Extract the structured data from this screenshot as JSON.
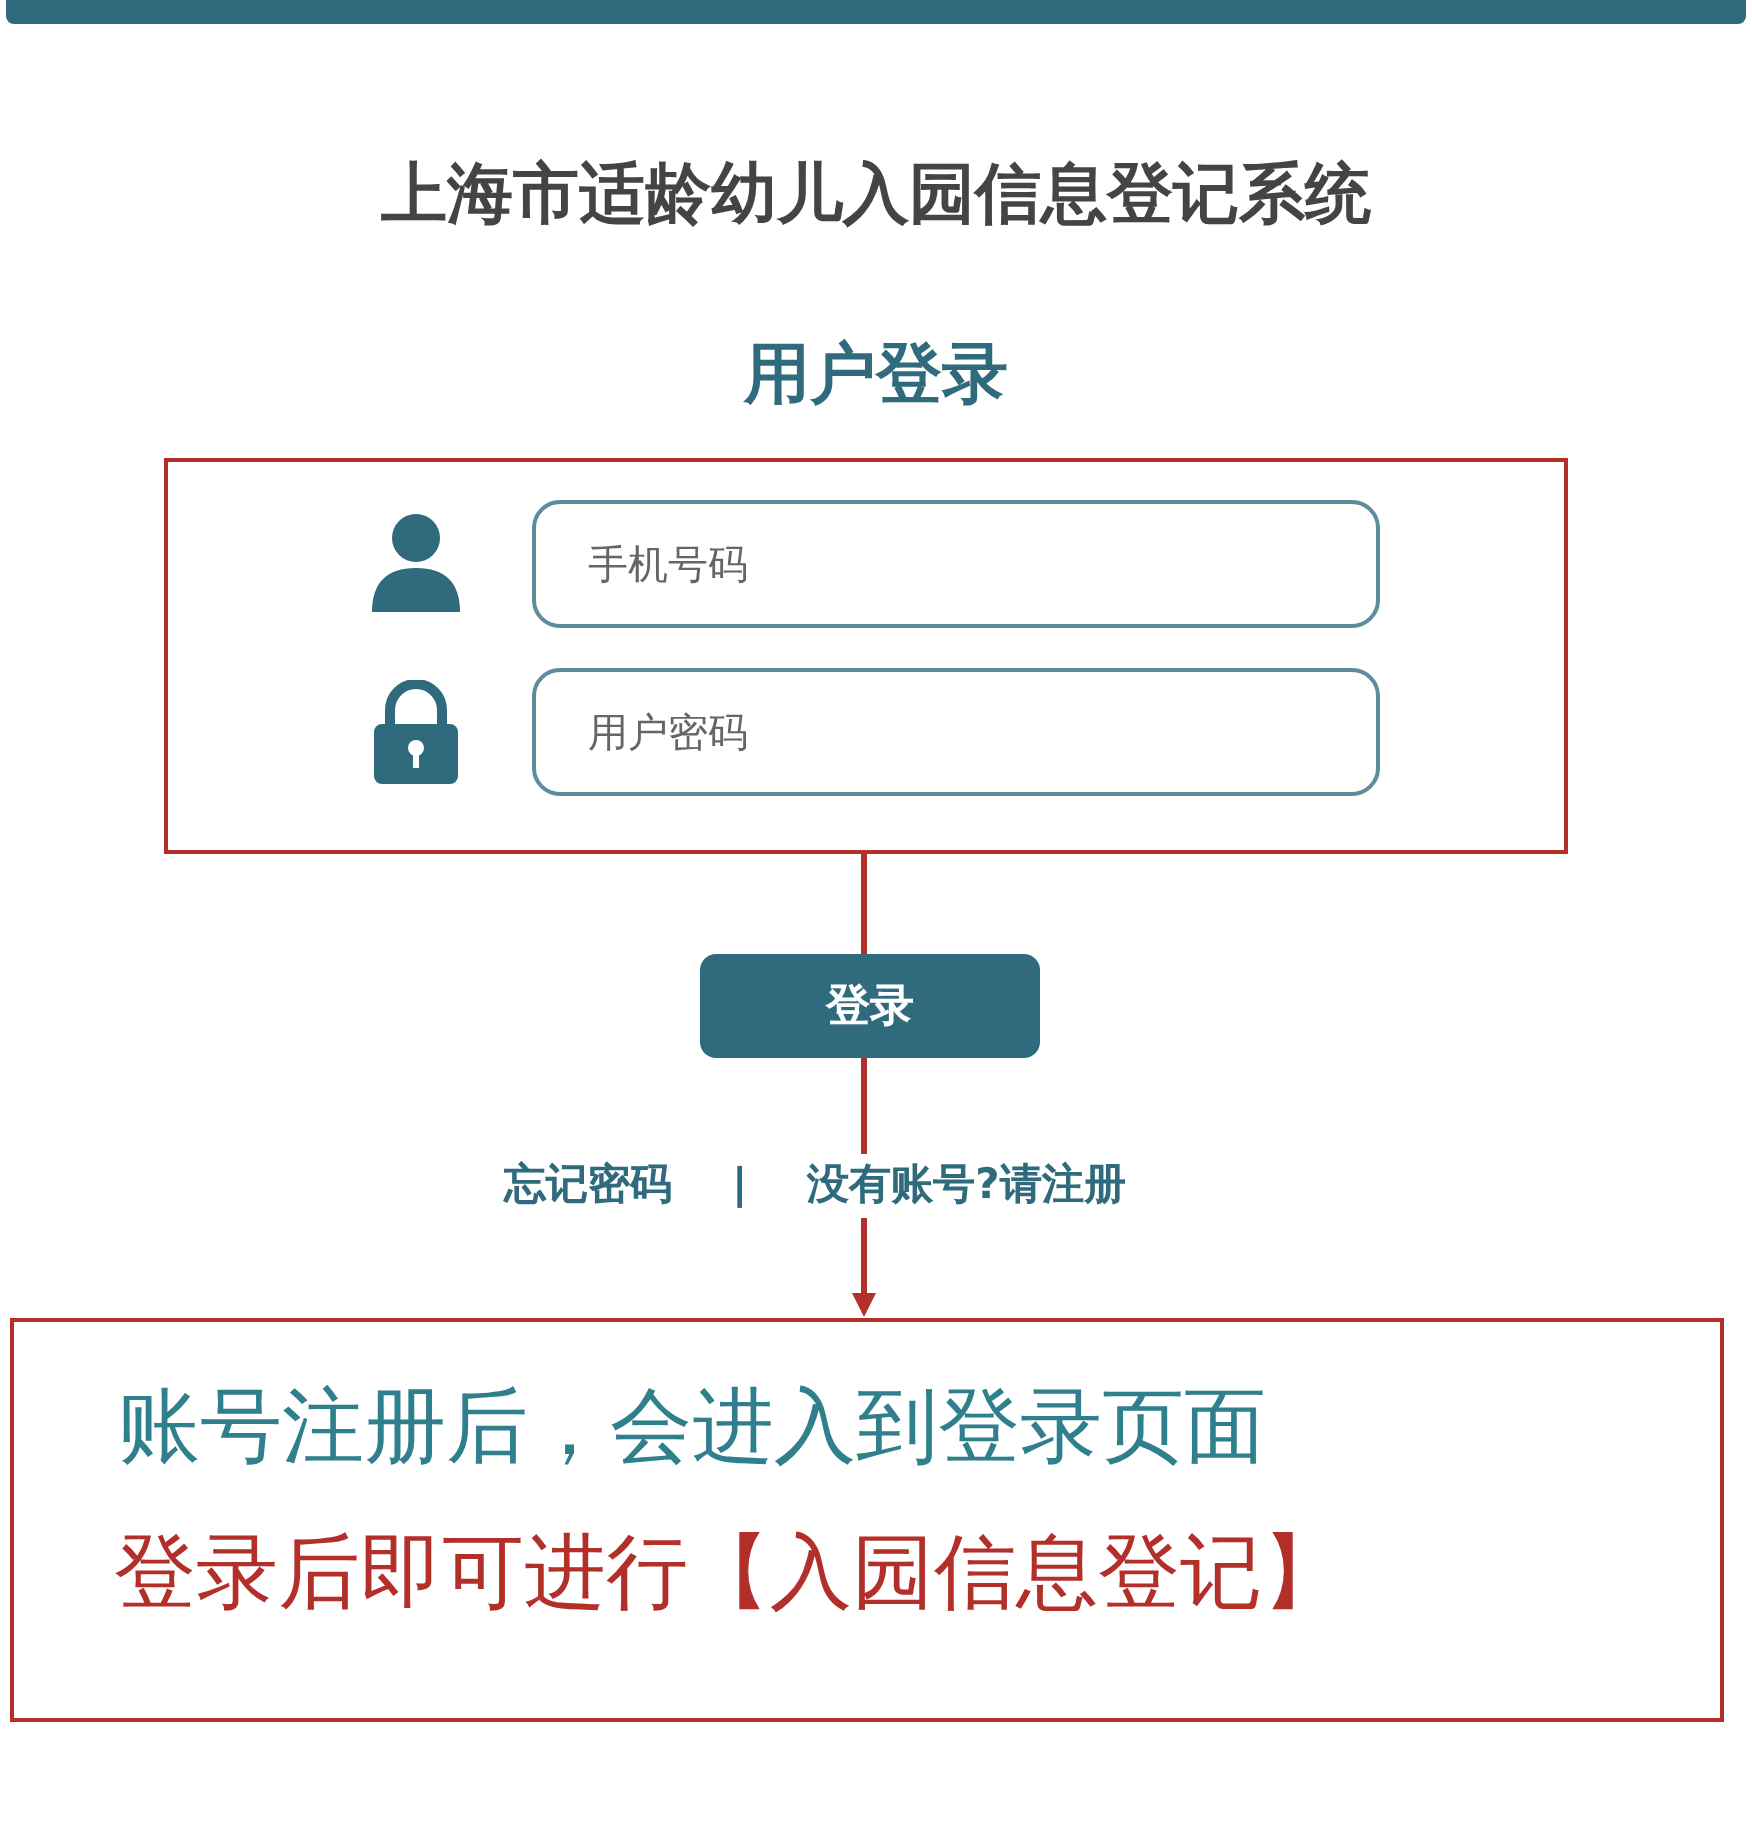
{
  "header": {
    "title": "上海市适龄幼儿入园信息登记系统",
    "subtitle": "用户登录"
  },
  "fields": [
    {
      "kind": "phone",
      "placeholder": "手机号码"
    },
    {
      "kind": "password",
      "placeholder": "用户密码"
    }
  ],
  "login_button": "登录",
  "links": {
    "forgot": "忘记密码",
    "separator": "|",
    "register": "没有账号?请注册"
  },
  "annotation": {
    "lines": [
      {
        "text": "账号注册后，会进入到登录页面",
        "color": "#2f7f8c"
      },
      {
        "text": "登录后即可进行【入园信息登记】",
        "color": "#b3302a"
      }
    ]
  }
}
